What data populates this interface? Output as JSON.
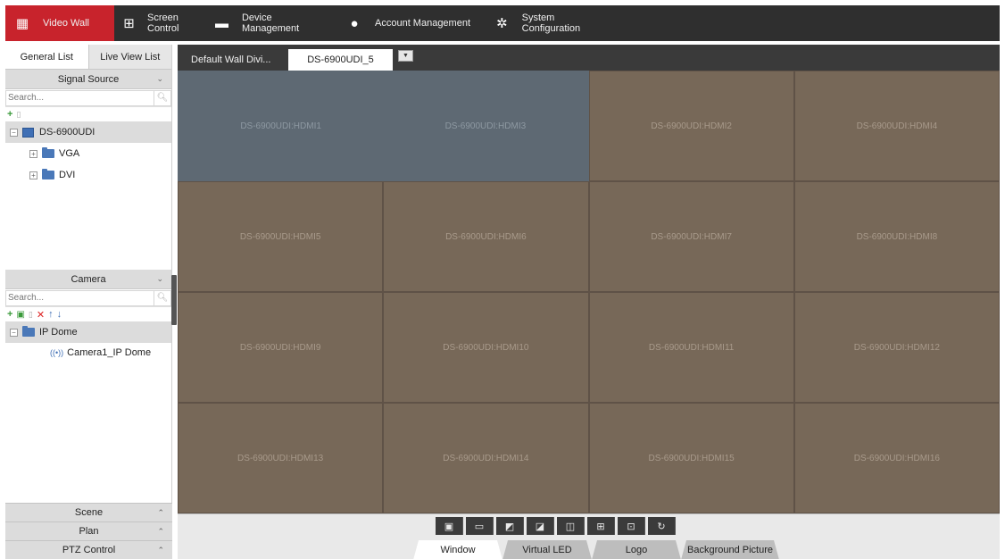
{
  "nav": {
    "items": [
      {
        "label": "Video Wall",
        "icon": "video-wall-icon"
      },
      {
        "label": "Screen Control",
        "icon": "screen-grid-icon"
      },
      {
        "label": "Device Management",
        "icon": "device-icon"
      },
      {
        "label": "Account Management",
        "icon": "user-icon"
      },
      {
        "label": "System Configuration",
        "icon": "gear-icon"
      }
    ],
    "active_color": "#c8232c"
  },
  "left": {
    "tabs": [
      "General List",
      "Live View List"
    ],
    "signal_source": {
      "title": "Signal Source",
      "search_placeholder": "Search...",
      "device": "DS-6900UDI",
      "children": [
        "VGA",
        "DVI"
      ]
    },
    "camera": {
      "title": "Camera",
      "search_placeholder": "Search...",
      "group": "IP Dome",
      "children": [
        "Camera1_IP Dome"
      ]
    },
    "footer": [
      "Scene",
      "Plan",
      "PTZ Control"
    ]
  },
  "wall": {
    "tabs": [
      "Default Wall Divi...",
      "DS-6900UDI_5"
    ],
    "cells": [
      "DS-6900UDI:HDMI1",
      "DS-6900UDI:HDMI3",
      "DS-6900UDI:HDMI2",
      "DS-6900UDI:HDMI4",
      "DS-6900UDI:HDMI5",
      "DS-6900UDI:HDMI6",
      "DS-6900UDI:HDMI7",
      "DS-6900UDI:HDMI8",
      "DS-6900UDI:HDMI9",
      "DS-6900UDI:HDMI10",
      "DS-6900UDI:HDMI11",
      "DS-6900UDI:HDMI12",
      "DS-6900UDI:HDMI13",
      "DS-6900UDI:HDMI14",
      "DS-6900UDI:HDMI15",
      "DS-6900UDI:HDMI16"
    ],
    "selected_color": "#5e6973",
    "cell_color": "#776858"
  },
  "bottom": {
    "tabs": [
      "Window",
      "Virtual LED",
      "Logo",
      "Background Picture"
    ]
  }
}
